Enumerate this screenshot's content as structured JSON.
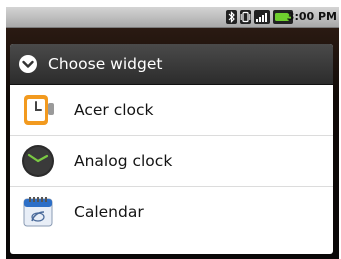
{
  "status_bar": {
    "time": "3:00 PM",
    "icons": [
      "bluetooth-icon",
      "vibrate-icon",
      "signal-icon",
      "battery-icon"
    ]
  },
  "dialog": {
    "title": "Choose widget",
    "header_icon": "chevron-down-circle-icon",
    "items": [
      {
        "label": "Acer clock",
        "icon": "acer-clock-icon"
      },
      {
        "label": "Analog clock",
        "icon": "analog-clock-icon"
      },
      {
        "label": "Calendar",
        "icon": "calendar-icon"
      }
    ]
  },
  "colors": {
    "header_bg": "#353535",
    "battery": "#6fcf2e",
    "acer_orange": "#f29a1f",
    "calendar_blue": "#2d6fc7"
  }
}
